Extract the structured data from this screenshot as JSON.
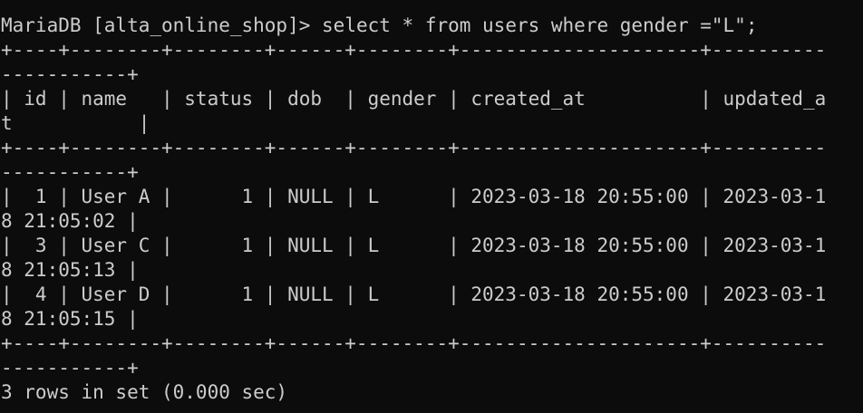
{
  "terminal": {
    "prompt": "MariaDB [alta_online_shop]>",
    "command": "select * from users where gender =\"L\";",
    "border_top": "+----+--------+--------+------+--------+---------------------+----------",
    "border_top_wrap": "-----------+",
    "header_row": "| id | name   | status | dob  | gender | created_at          | updated_a",
    "header_row_wrap": "t           |",
    "border_mid": "+----+--------+--------+------+--------+---------------------+----------",
    "border_mid_wrap": "-----------+",
    "rows": [
      {
        "line": "|  1 | User A |      1 | NULL | L      | 2023-03-18 20:55:00 | 2023-03-1",
        "wrap": "8 21:05:02 |"
      },
      {
        "line": "|  3 | User C |      1 | NULL | L      | 2023-03-18 20:55:00 | 2023-03-1",
        "wrap": "8 21:05:13 |"
      },
      {
        "line": "|  4 | User D |      1 | NULL | L      | 2023-03-18 20:55:00 | 2023-03-1",
        "wrap": "8 21:05:15 |"
      }
    ],
    "border_bottom": "+----+--------+--------+------+--------+---------------------+----------",
    "border_bottom_wrap": "-----------+",
    "result": "3 rows in set (0.000 sec)"
  },
  "colors": {
    "background": "#0c0c0c",
    "text": "#cccccc"
  }
}
